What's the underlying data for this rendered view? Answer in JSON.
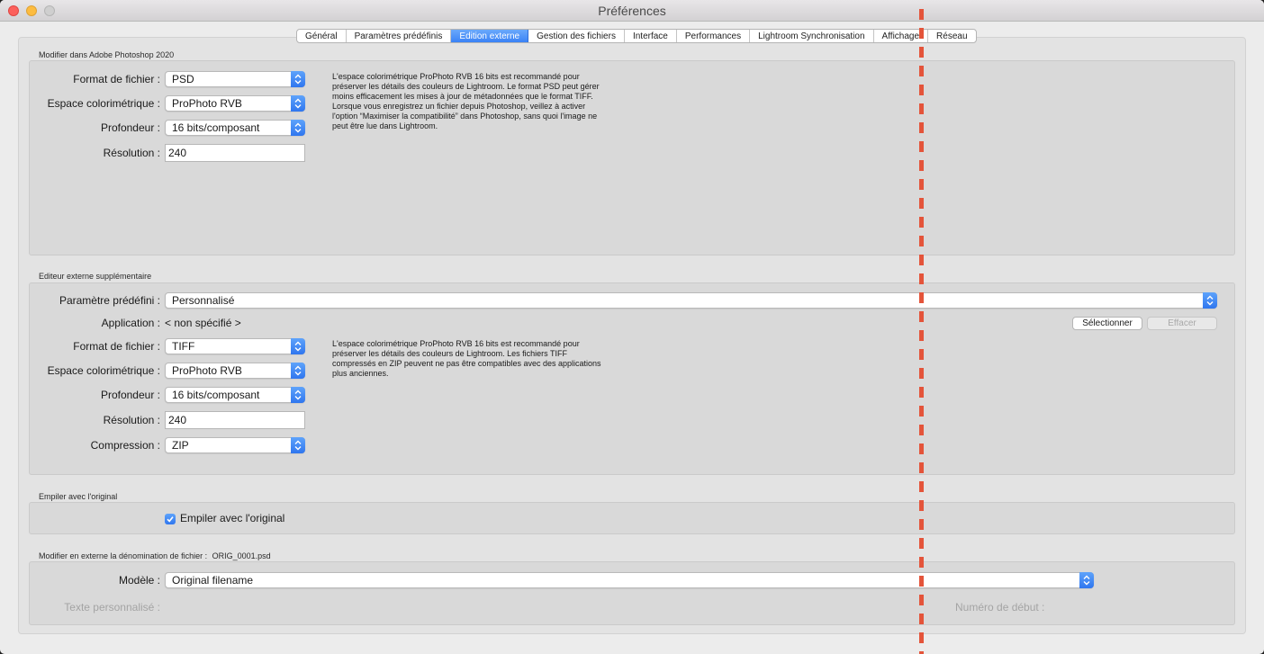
{
  "window": {
    "title": "Préférences"
  },
  "tabs": [
    {
      "label": "Général"
    },
    {
      "label": "Paramètres prédéfinis"
    },
    {
      "label": "Edition externe"
    },
    {
      "label": "Gestion des fichiers"
    },
    {
      "label": "Interface"
    },
    {
      "label": "Performances"
    },
    {
      "label": "Lightroom Synchronisation"
    },
    {
      "label": "Affichage"
    },
    {
      "label": "Réseau"
    }
  ],
  "active_tab": "Edition externe",
  "photoshop": {
    "title": "Modifier dans Adobe Photoshop 2020",
    "format_label": "Format de fichier :",
    "format_value": "PSD",
    "colorspace_label": "Espace colorimétrique :",
    "colorspace_value": "ProPhoto RVB",
    "depth_label": "Profondeur :",
    "depth_value": "16 bits/composant",
    "resolution_label": "Résolution :",
    "resolution_value": "240",
    "hint": "L'espace colorimétrique ProPhoto RVB 16 bits est recommandé pour préserver les détails des couleurs de Lightroom. Le format PSD peut gérer moins efficacement les mises à jour de métadonnées que le format TIFF. Lorsque vous enregistrez un fichier depuis Photoshop, veillez à activer l'option “Maximiser la compatibilité” dans Photoshop, sans quoi l'image ne peut être lue dans Lightroom."
  },
  "external": {
    "title": "Editeur externe supplémentaire",
    "preset_label": "Paramètre prédéfini :",
    "preset_value": "Personnalisé",
    "app_label": "Application :",
    "app_value": "< non spécifié >",
    "select_button": "Sélectionner",
    "clear_button": "Effacer",
    "format_label": "Format de fichier :",
    "format_value": "TIFF",
    "colorspace_label": "Espace colorimétrique :",
    "colorspace_value": "ProPhoto RVB",
    "depth_label": "Profondeur :",
    "depth_value": "16 bits/composant",
    "resolution_label": "Résolution :",
    "resolution_value": "240",
    "compression_label": "Compression :",
    "compression_value": "ZIP",
    "hint": "L'espace colorimétrique ProPhoto RVB 16 bits est recommandé pour préserver les détails des couleurs de Lightroom. Les fichiers TIFF compressés en ZIP peuvent ne pas être compatibles avec des applications plus anciennes."
  },
  "stack": {
    "title": "Empiler avec l'original",
    "checkbox_label": "Empiler avec l'original",
    "checked": true
  },
  "naming": {
    "title": "Modifier en externe la dénomination de fichier :",
    "example": "ORIG_0001.psd",
    "template_label": "Modèle :",
    "template_value": "Original filename",
    "custom_text_label": "Texte personnalisé :",
    "start_number_label": "Numéro de début :"
  },
  "colors": {
    "accent": "#3a82f6",
    "guide_line": "#e4543a"
  }
}
